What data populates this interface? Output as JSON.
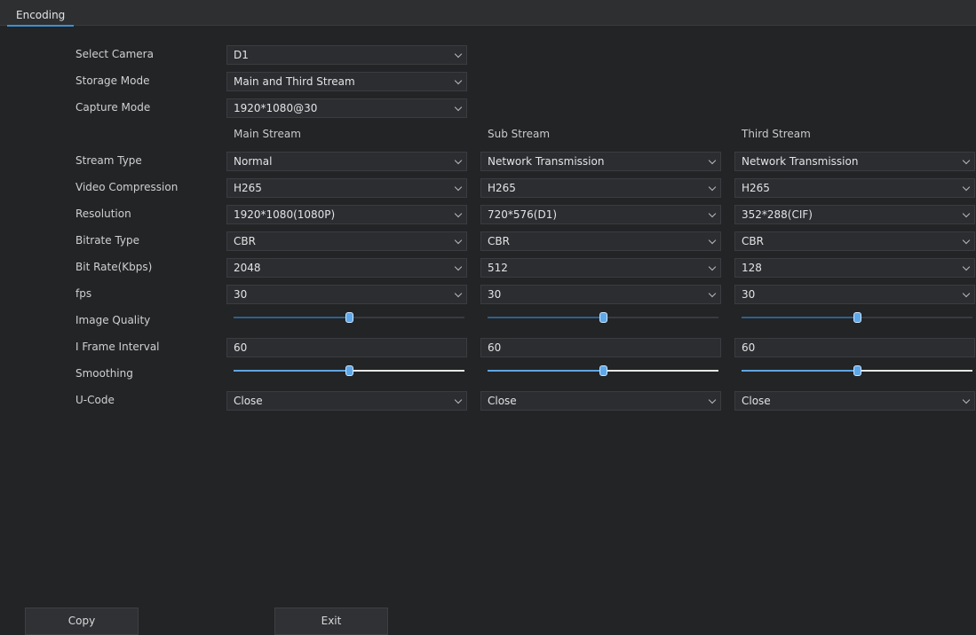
{
  "tab": {
    "label": "Encoding"
  },
  "labels": {
    "select_camera": "Select Camera",
    "storage_mode": "Storage Mode",
    "capture_mode": "Capture Mode",
    "stream_type": "Stream Type",
    "video_compression": "Video Compression",
    "resolution": "Resolution",
    "bitrate_type": "Bitrate Type",
    "bit_rate": "Bit Rate(Kbps)",
    "fps": "fps",
    "image_quality": "Image Quality",
    "i_frame_interval": "I Frame Interval",
    "smoothing": "Smoothing",
    "u_code": "U-Code"
  },
  "general": {
    "select_camera": "D1",
    "storage_mode": "Main and Third Stream",
    "capture_mode": "1920*1080@30"
  },
  "streams": [
    {
      "header": "Main Stream",
      "stream_type": "Normal",
      "video_compression": "H265",
      "resolution": "1920*1080(1080P)",
      "bitrate_type": "CBR",
      "bit_rate": "2048",
      "fps": "30",
      "image_quality_level": 0.5,
      "i_frame_interval": "60",
      "smoothing_level": 0.5,
      "u_code": "Close"
    },
    {
      "header": "Sub Stream",
      "stream_type": "Network Transmission",
      "video_compression": "H265",
      "resolution": "720*576(D1)",
      "bitrate_type": "CBR",
      "bit_rate": "512",
      "fps": "30",
      "image_quality_level": 0.5,
      "i_frame_interval": "60",
      "smoothing_level": 0.5,
      "u_code": "Close"
    },
    {
      "header": "Third Stream",
      "stream_type": "Network Transmission",
      "video_compression": "H265",
      "resolution": "352*288(CIF)",
      "bitrate_type": "CBR",
      "bit_rate": "128",
      "fps": "30",
      "image_quality_level": 0.5,
      "i_frame_interval": "60",
      "smoothing_level": 0.5,
      "u_code": "Close"
    }
  ],
  "buttons": {
    "copy": "Copy",
    "exit": "Exit"
  },
  "colors": {
    "accent": "#5ea8ea",
    "background": "#232426",
    "control_bg": "#2c2d30"
  }
}
